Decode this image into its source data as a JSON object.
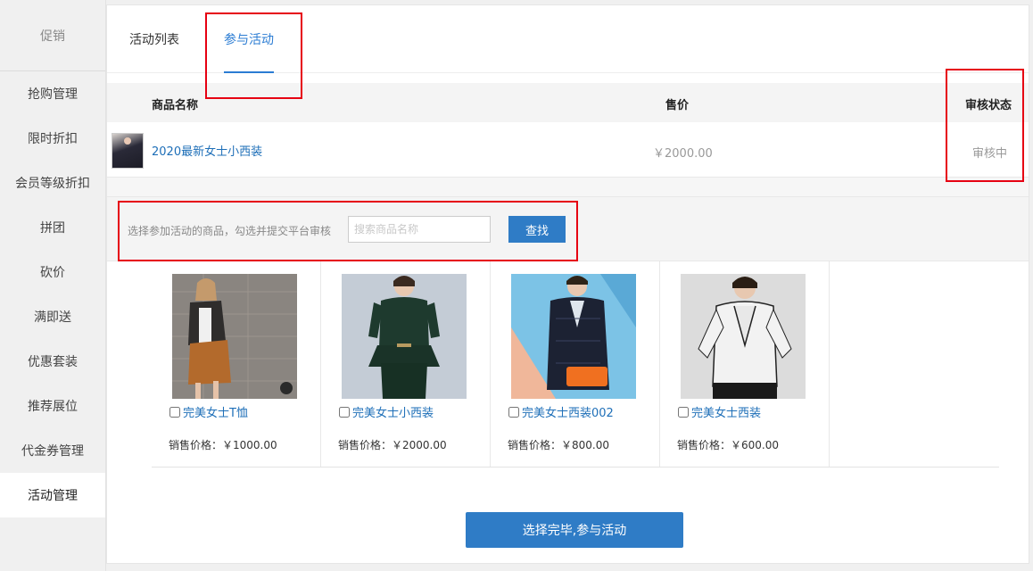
{
  "sidebar": {
    "header": "促销",
    "items": [
      {
        "label": "抢购管理"
      },
      {
        "label": "限时折扣"
      },
      {
        "label": "会员等级折扣"
      },
      {
        "label": "拼团"
      },
      {
        "label": "砍价"
      },
      {
        "label": "满即送"
      },
      {
        "label": "优惠套装"
      },
      {
        "label": "推荐展位"
      },
      {
        "label": "代金券管理"
      },
      {
        "label": "活动管理",
        "active": true
      }
    ]
  },
  "tabs": [
    {
      "label": "活动列表"
    },
    {
      "label": "参与活动",
      "active": true
    }
  ],
  "audit_table": {
    "headers": {
      "name": "商品名称",
      "price": "售价",
      "status": "审核状态"
    },
    "rows": [
      {
        "name": "2020最新女士小西装",
        "price": "￥2000.00",
        "status": "审核中"
      }
    ]
  },
  "search": {
    "hint": "选择参加活动的商品，勾选并提交平台审核",
    "placeholder": "搜索商品名称",
    "button_label": "查找"
  },
  "products": [
    {
      "name": "完美女士T恤",
      "price": "销售价格：￥1000.00"
    },
    {
      "name": "完美女士小西装",
      "price": "销售价格：￥2000.00"
    },
    {
      "name": "完美女士西装002",
      "price": "销售价格：￥800.00"
    },
    {
      "name": "完美女士西装",
      "price": "销售价格：￥600.00"
    }
  ],
  "submit_label": "选择完毕,参与活动",
  "colors": {
    "accent": "#2f7cc6",
    "link": "#1e6fb8",
    "annotation": "#e60012"
  }
}
